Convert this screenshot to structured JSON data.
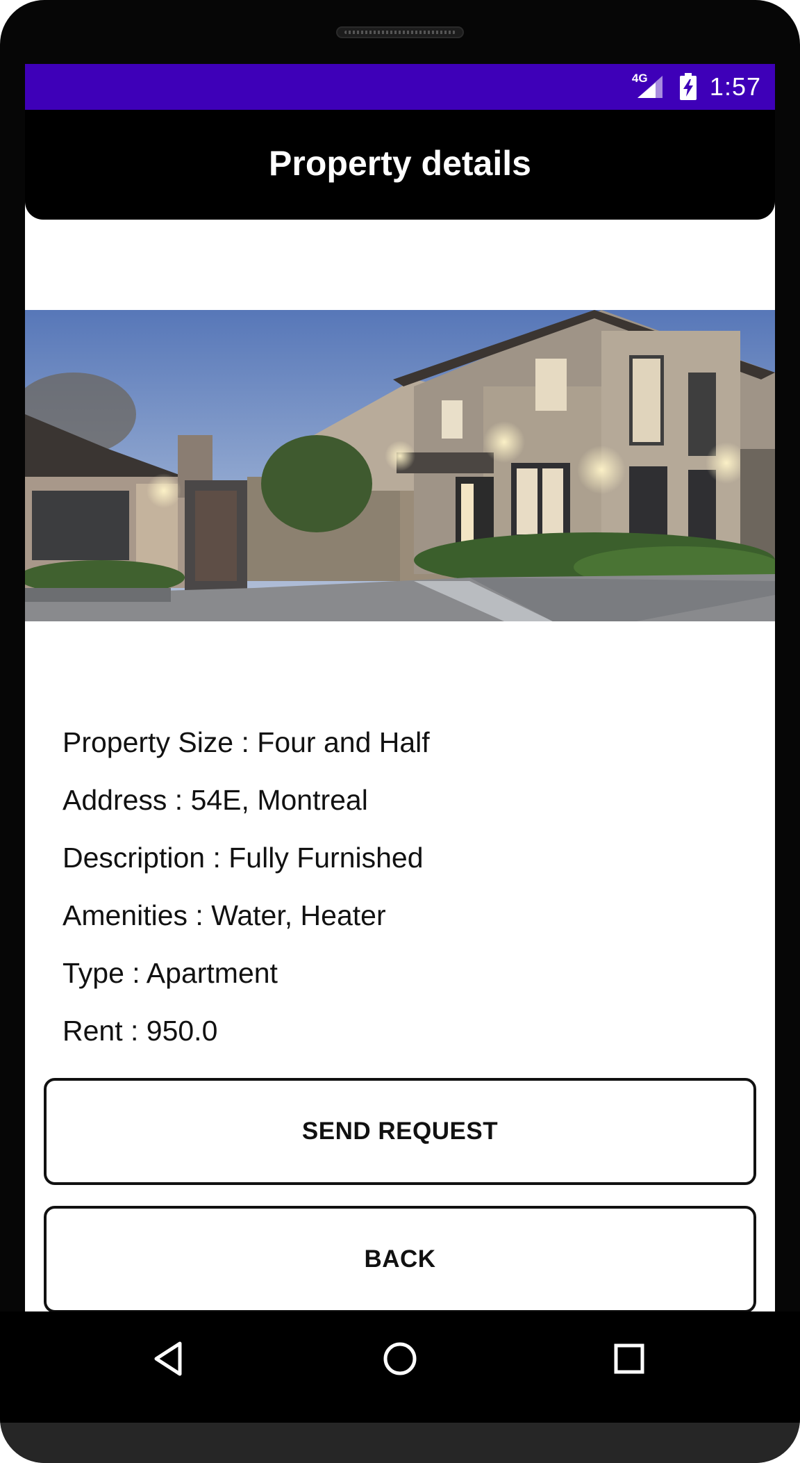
{
  "status_bar": {
    "network": "4G",
    "time": "1:57",
    "accent_color": "#3e00b8"
  },
  "app_bar": {
    "title": "Property details"
  },
  "hero_image": {
    "description_icon": "house-photo"
  },
  "details": [
    "Property Size : Four and Half",
    "Address : 54E, Montreal",
    "Description : Fully Furnished",
    "Amenities : Water, Heater",
    "Type : Apartment",
    "Rent : 950.0"
  ],
  "buttons": {
    "send_request": "SEND REQUEST",
    "back": "BACK"
  },
  "nav": {
    "back_icon": "triangle-back-icon",
    "home_icon": "circle-home-icon",
    "recents_icon": "square-recents-icon"
  }
}
